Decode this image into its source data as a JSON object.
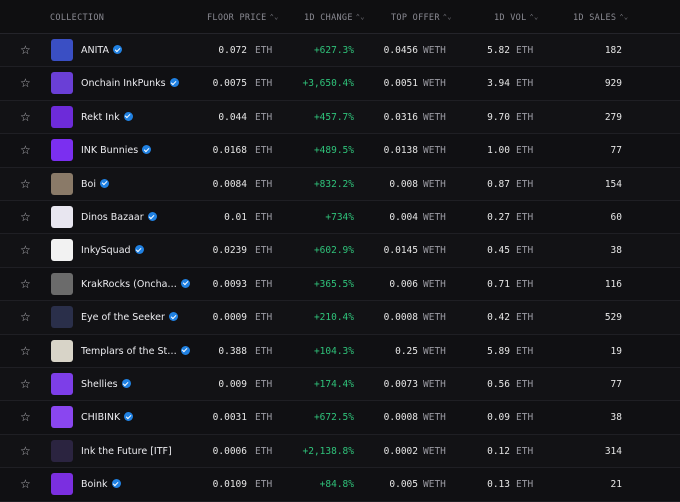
{
  "header": {
    "collection": "COLLECTION",
    "floor_price": "FLOOR PRICE",
    "change_1d": "1D CHANGE",
    "top_offer": "TOP OFFER",
    "vol_1d": "1D VOL",
    "sales_1d": "1D SALES",
    "sort_glyph": "⌃⌄"
  },
  "star_glyph": "☆",
  "rows": [
    {
      "name": "ANITA",
      "verified": true,
      "floor": "0.072",
      "floor_unit": "ETH",
      "change": "+627.3%",
      "offer": "0.0456",
      "offer_unit": "WETH",
      "vol": "5.82",
      "vol_unit": "ETH",
      "sales": "182",
      "thumb_color": "#3a4fc4",
      "thumb_icon": "cat-icon"
    },
    {
      "name": "Onchain InkPunks",
      "verified": true,
      "floor": "0.0075",
      "floor_unit": "ETH",
      "change": "+3,650.4%",
      "offer": "0.0051",
      "offer_unit": "WETH",
      "vol": "3.94",
      "vol_unit": "ETH",
      "sales": "929",
      "thumb_color": "#6a3fd6",
      "thumb_icon": "punk-icon"
    },
    {
      "name": "Rekt Ink",
      "verified": true,
      "floor": "0.044",
      "floor_unit": "ETH",
      "change": "+457.7%",
      "offer": "0.0316",
      "offer_unit": "WETH",
      "vol": "9.70",
      "vol_unit": "ETH",
      "sales": "279",
      "thumb_color": "#6d2bd9",
      "thumb_icon": "alien-icon"
    },
    {
      "name": "INK Bunnies",
      "verified": true,
      "floor": "0.0168",
      "floor_unit": "ETH",
      "change": "+489.5%",
      "offer": "0.0138",
      "offer_unit": "WETH",
      "vol": "1.00",
      "vol_unit": "ETH",
      "sales": "77",
      "thumb_color": "#7b2ff0",
      "thumb_icon": "bunny-icon"
    },
    {
      "name": "Boi",
      "verified": true,
      "floor": "0.0084",
      "floor_unit": "ETH",
      "change": "+832.2%",
      "offer": "0.008",
      "offer_unit": "WETH",
      "vol": "0.87",
      "vol_unit": "ETH",
      "sales": "154",
      "thumb_color": "#8a7a68",
      "thumb_icon": "boi-icon"
    },
    {
      "name": "Dinos Bazaar",
      "verified": true,
      "floor": "0.01",
      "floor_unit": "ETH",
      "change": "+734%",
      "offer": "0.004",
      "offer_unit": "WETH",
      "vol": "0.27",
      "vol_unit": "ETH",
      "sales": "60",
      "thumb_color": "#e8e6f0",
      "thumb_icon": "dino-icon"
    },
    {
      "name": "InkySquad",
      "verified": true,
      "floor": "0.0239",
      "floor_unit": "ETH",
      "change": "+602.9%",
      "offer": "0.0145",
      "offer_unit": "WETH",
      "vol": "0.45",
      "vol_unit": "ETH",
      "sales": "38",
      "thumb_color": "#f2f2f2",
      "thumb_icon": "octopus-icon"
    },
    {
      "name": "KrakRocks (Oncha…",
      "verified": true,
      "floor": "0.0093",
      "floor_unit": "ETH",
      "change": "+365.5%",
      "offer": "0.006",
      "offer_unit": "WETH",
      "vol": "0.71",
      "vol_unit": "ETH",
      "sales": "116",
      "thumb_color": "#6b6b6b",
      "thumb_icon": "rock-icon"
    },
    {
      "name": "Eye of the Seeker",
      "verified": true,
      "floor": "0.0009",
      "floor_unit": "ETH",
      "change": "+210.4%",
      "offer": "0.0008",
      "offer_unit": "WETH",
      "vol": "0.42",
      "vol_unit": "ETH",
      "sales": "529",
      "thumb_color": "#2a2f4a",
      "thumb_icon": "eye-icon"
    },
    {
      "name": "Templars of the St…",
      "verified": true,
      "floor": "0.388",
      "floor_unit": "ETH",
      "change": "+104.3%",
      "offer": "0.25",
      "offer_unit": "WETH",
      "vol": "5.89",
      "vol_unit": "ETH",
      "sales": "19",
      "thumb_color": "#d8d4c8",
      "thumb_icon": "templar-icon"
    },
    {
      "name": "Shellies",
      "verified": true,
      "floor": "0.009",
      "floor_unit": "ETH",
      "change": "+174.4%",
      "offer": "0.0073",
      "offer_unit": "WETH",
      "vol": "0.56",
      "vol_unit": "ETH",
      "sales": "77",
      "thumb_color": "#7d3ee8",
      "thumb_icon": "shell-icon"
    },
    {
      "name": "CHIBINK",
      "verified": true,
      "floor": "0.0031",
      "floor_unit": "ETH",
      "change": "+672.5%",
      "offer": "0.0008",
      "offer_unit": "WETH",
      "vol": "0.09",
      "vol_unit": "ETH",
      "sales": "38",
      "thumb_color": "#8a46f0",
      "thumb_icon": "chibi-icon"
    },
    {
      "name": "Ink the Future [ITF]",
      "verified": false,
      "floor": "0.0006",
      "floor_unit": "ETH",
      "change": "+2,138.8%",
      "offer": "0.0002",
      "offer_unit": "WETH",
      "vol": "0.12",
      "vol_unit": "ETH",
      "sales": "314",
      "thumb_color": "#2b2440",
      "thumb_icon": "future-icon"
    },
    {
      "name": "Boink",
      "verified": true,
      "floor": "0.0109",
      "floor_unit": "ETH",
      "change": "+84.8%",
      "offer": "0.005",
      "offer_unit": "WETH",
      "vol": "0.13",
      "vol_unit": "ETH",
      "sales": "21",
      "thumb_color": "#7b2fe0",
      "thumb_icon": "boink-icon"
    }
  ]
}
